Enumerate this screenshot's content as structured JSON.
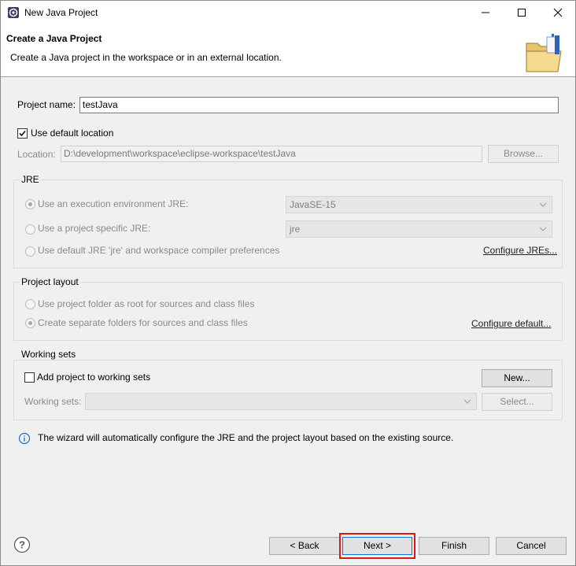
{
  "window": {
    "title": "New Java Project"
  },
  "banner": {
    "title": "Create a Java Project",
    "description": "Create a Java project in the workspace or in an external location."
  },
  "project_name": {
    "label": "Project name:",
    "value": "testJava"
  },
  "location": {
    "use_default_label": "Use default location",
    "use_default_checked": true,
    "label": "Location:",
    "value": "D:\\development\\workspace\\eclipse-workspace\\testJava",
    "browse_label": "Browse..."
  },
  "jre": {
    "group_title": "JRE",
    "exec_env_label": "Use an execution environment JRE:",
    "exec_env_value": "JavaSE-15",
    "specific_label": "Use a project specific JRE:",
    "specific_value": "jre",
    "default_label": "Use default JRE 'jre' and workspace compiler preferences",
    "configure_link": "Configure JREs..."
  },
  "layout": {
    "group_title": "Project layout",
    "root_label": "Use project folder as root for sources and class files",
    "separate_label": "Create separate folders for sources and class files",
    "configure_link": "Configure default..."
  },
  "working_sets": {
    "group_title": "Working sets",
    "add_label": "Add project to working sets",
    "new_label": "New...",
    "sets_label": "Working sets:",
    "select_label": "Select..."
  },
  "info": {
    "message": "The wizard will automatically configure the JRE and the project layout based on the existing source."
  },
  "footer": {
    "back_label": "< Back",
    "next_label": "Next >",
    "finish_label": "Finish",
    "cancel_label": "Cancel"
  },
  "colors": {
    "highlight": "#d9181a",
    "focus": "#0078d7",
    "info": "#1a6fc4"
  }
}
